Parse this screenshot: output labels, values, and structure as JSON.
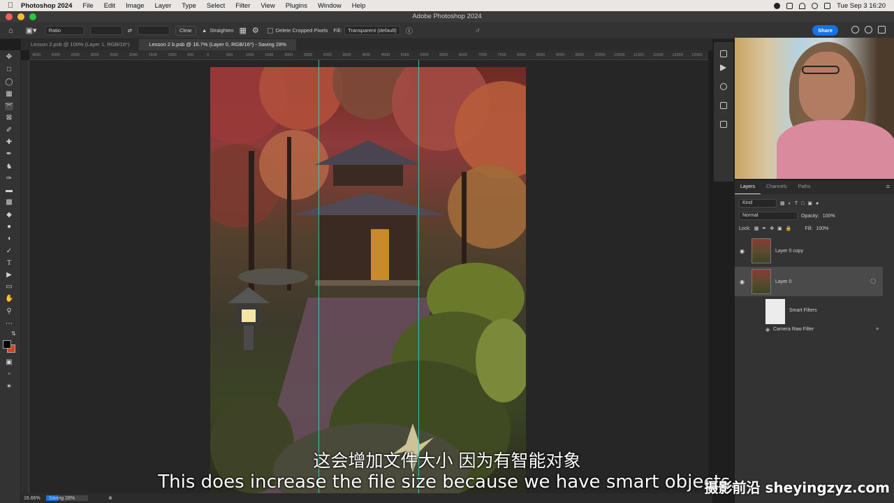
{
  "menubar": {
    "app": "Photoshop 2024",
    "items": [
      "File",
      "Edit",
      "Image",
      "Layer",
      "Type",
      "Select",
      "Filter",
      "View",
      "Plugins",
      "Window",
      "Help"
    ],
    "datetime": "Tue Sep 3  16:20"
  },
  "window": {
    "title": "Adobe Photoshop 2024"
  },
  "options": {
    "ratio": "Ratio",
    "clear": "Clear",
    "straighten": "Straighten",
    "delete_cropped": "Delete Cropped Pixels",
    "fill_label": "Fill:",
    "fill_value": "Transparent (default)",
    "share": "Share"
  },
  "tabs": [
    {
      "label": "Lesson 2.psb @ 100% (Layer 1, RGB/16*)"
    },
    {
      "label": "Lesson 2 b.psb @ 16.7% (Layer 0, RGB/16*) - Saving 28%"
    }
  ],
  "ruler_ticks": [
    "4500",
    "4000",
    "3500",
    "3000",
    "2500",
    "2000",
    "1500",
    "1000",
    "500",
    "0",
    "500",
    "1000",
    "1500",
    "2000",
    "2500",
    "3000",
    "3500",
    "4000",
    "4500",
    "5000",
    "5500",
    "6000",
    "6500",
    "7000",
    "7500",
    "8000",
    "8500",
    "9000",
    "9500",
    "10000",
    "10500",
    "11000",
    "11500",
    "12000",
    "12500"
  ],
  "layers_panel": {
    "tabs": [
      "Layers",
      "Channels",
      "Paths"
    ],
    "kind": "Kind",
    "blend_mode": "Normal",
    "opacity_label": "Opacity:",
    "opacity_value": "100%",
    "lock_label": "Lock:",
    "fill_label": "Fill:",
    "fill_value": "100%",
    "layers": [
      {
        "name": "Layer 0 copy"
      },
      {
        "name": "Layer 0"
      }
    ],
    "smart_filters": "Smart Filters",
    "camera_raw": "Camera Raw Filter"
  },
  "status": {
    "zoom": "16.66%",
    "saving": "Saving 28%",
    "saving_progress": 0.28
  },
  "subtitles": {
    "cn": "这会增加文件大小 因为有智能对象",
    "en": "This does increase the file size because we have smart objects."
  },
  "watermark": "摄影前沿 sheyingzyz.com",
  "colors": {
    "accent": "#1473e6",
    "guide": "#38d0c8"
  }
}
